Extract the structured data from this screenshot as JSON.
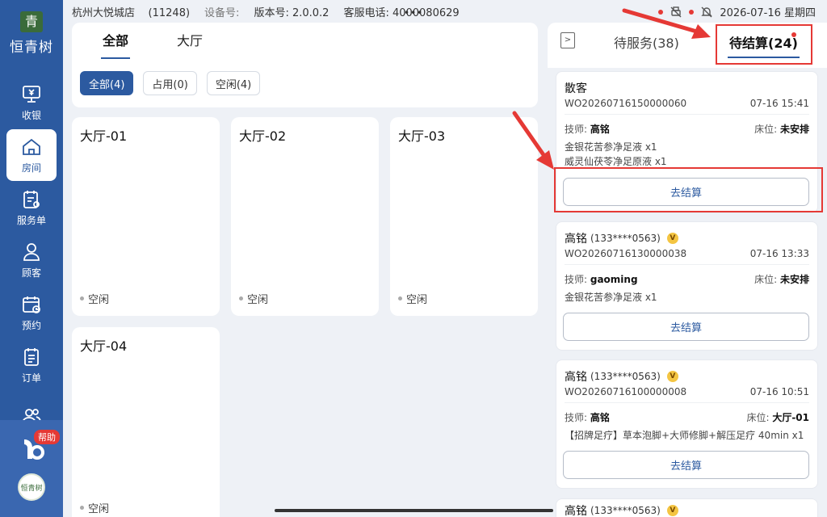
{
  "brand": {
    "mark": "青",
    "name": "恒青树",
    "avatar_text": "恒青树"
  },
  "sidebar": {
    "items": [
      {
        "label": "收银",
        "icon": "cashier-icon"
      },
      {
        "label": "房间",
        "icon": "home-icon",
        "active": true
      },
      {
        "label": "服务单",
        "icon": "service-order-icon"
      },
      {
        "label": "顾客",
        "icon": "person-icon"
      },
      {
        "label": "预约",
        "icon": "calendar-icon"
      },
      {
        "label": "订单",
        "icon": "order-list-icon"
      },
      {
        "label": "",
        "icon": "staff-icon"
      }
    ],
    "help_label": "帮助"
  },
  "status": {
    "store": "杭州大悦城店",
    "store_id": "(11248)",
    "device": "设备号:",
    "version": "版本号: 2.0.0.2",
    "hotline": "客服电话: 4000080629",
    "datetime": "2026-07-16 星期四"
  },
  "filter": {
    "tabs": [
      "全部",
      "大厅"
    ],
    "chips": [
      "全部(4)",
      "占用(0)",
      "空闲(4)"
    ]
  },
  "rooms": [
    {
      "name": "大厅-01",
      "status": "空闲"
    },
    {
      "name": "大厅-02",
      "status": "空闲"
    },
    {
      "name": "大厅-03",
      "status": "空闲"
    },
    {
      "name": "大厅-04",
      "status": "空闲"
    }
  ],
  "right_panel": {
    "tabs": [
      "待服务(38)",
      "待结算(24)"
    ],
    "orders": [
      {
        "customer": "散客",
        "phone": "",
        "vip": false,
        "order_no": "WO20260716150000060",
        "time": "07-16 15:41",
        "tech_label": "技师: ",
        "tech": "高铭",
        "bed_label": "床位: ",
        "bed": "未安排",
        "items": [
          "金银花苦参净足液 x1",
          "威灵仙茯苓净足原液 x1"
        ],
        "button": "去结算"
      },
      {
        "customer": "高铭",
        "phone": "(133****0563)",
        "vip": true,
        "order_no": "WO20260716130000038",
        "time": "07-16 13:33",
        "tech_label": "技师: ",
        "tech": "gaoming",
        "bed_label": "床位: ",
        "bed": "未安排",
        "items": [
          "金银花苦参净足液 x1"
        ],
        "button": "去结算"
      },
      {
        "customer": "高铭",
        "phone": "(133****0563)",
        "vip": true,
        "order_no": "WO20260716100000008",
        "time": "07-16 10:51",
        "tech_label": "技师: ",
        "tech": "高铭",
        "bed_label": "床位: ",
        "bed": "大厅-01",
        "items": [
          "【招牌足疗】草本泡脚+大师修脚+解压足疗 40min x1"
        ],
        "button": "去结算"
      },
      {
        "customer": "高铭",
        "phone": "(133****0563)",
        "vip": true
      }
    ]
  },
  "vip_mark": "V",
  "colors": {
    "primary": "#2c5aa0",
    "highlight": "#e53935"
  }
}
